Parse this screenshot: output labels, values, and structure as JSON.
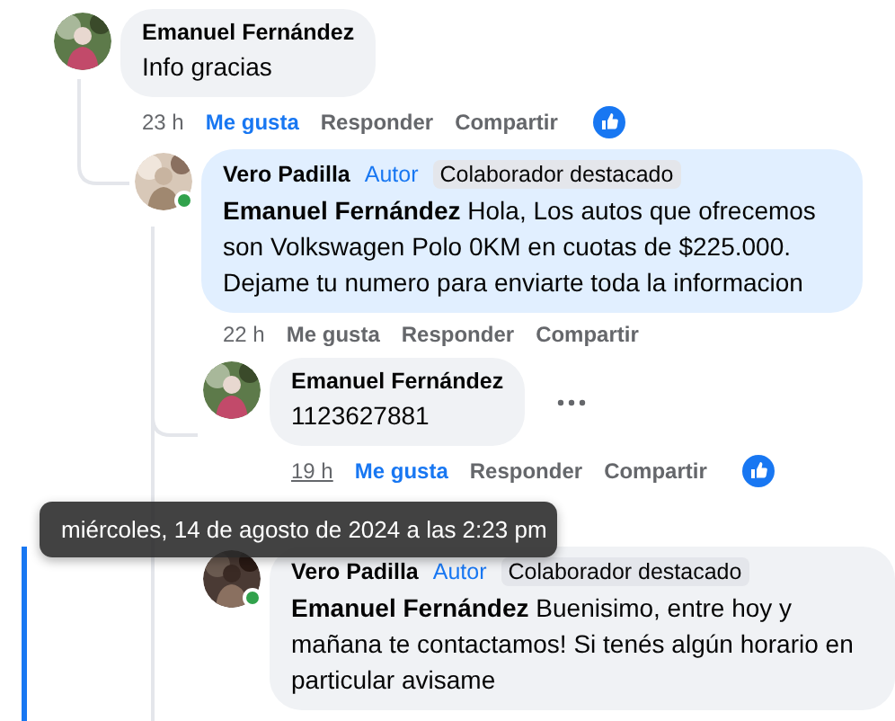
{
  "comments": [
    {
      "author": "Emanuel Fernández",
      "online": false,
      "tinted": false,
      "highlighted": false,
      "text": "Info gracias",
      "time": "23 h",
      "time_hovered": false,
      "liked": true,
      "more": false,
      "actions": [
        "Me gusta",
        "Responder",
        "Compartir"
      ],
      "children": [
        {
          "author": "Vero Padilla",
          "online": true,
          "tinted": true,
          "highlighted": false,
          "badges": [
            {
              "label": "Autor",
              "kind": "role"
            },
            {
              "label": "Colaborador destacado",
              "kind": "tag"
            }
          ],
          "text": "**Emanuel Fernández** Hola, Los autos que ofrecemos son Volkswagen Polo 0KM en cuotas de $225.000. Dejame tu numero para enviarte toda la informacion",
          "time": "22 h",
          "time_hovered": false,
          "liked": false,
          "more": false,
          "actions": [
            "Me gusta",
            "Responder",
            "Compartir"
          ],
          "children": [
            {
              "author": "Emanuel Fernández",
              "online": false,
              "tinted": false,
              "highlighted": false,
              "text": "1123627881",
              "time": "19 h",
              "time_hovered": true,
              "liked": true,
              "more": true,
              "actions": [
                "Me gusta",
                "Responder",
                "Compartir"
              ]
            },
            {
              "author": "Vero Padilla",
              "online": true,
              "tinted": false,
              "highlighted": true,
              "badges": [
                {
                  "label": "Autor",
                  "kind": "role"
                },
                {
                  "label": "Colaborador destacado",
                  "kind": "tag"
                }
              ],
              "text": "**Emanuel Fernández** Buenisimo, entre hoy y mañana te contactamos! Si tenés algún horario en particular avisame"
            }
          ]
        }
      ]
    }
  ],
  "tooltip": {
    "text": "miércoles, 14 de agosto de 2024 a las 2:23 pm"
  }
}
